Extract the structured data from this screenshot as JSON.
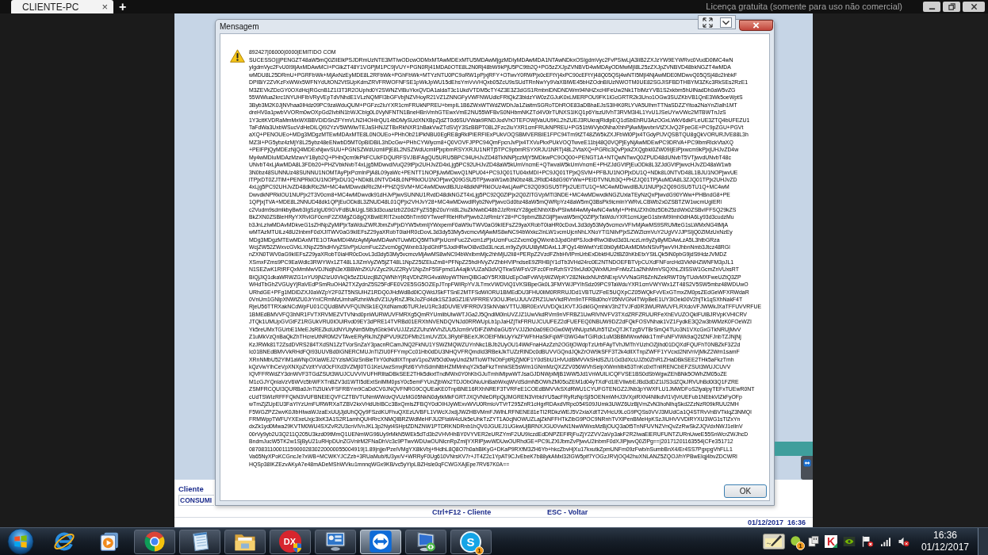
{
  "top_bar": {
    "tabs": [
      {
        "label": "CLIENTE-PC",
        "selected": true,
        "close": "×"
      }
    ],
    "new_tab": "+",
    "license_notice": "Licença gratuita (somente para uso não comercial)"
  },
  "remote_app": {
    "customer_label": "Cliente",
    "customer_value": "CONSUMI",
    "shortcuts": [
      "Ctrl+F12 - Cliente",
      "ESC - Voltar"
    ],
    "datetime": "01/12/2017  16:36"
  },
  "dialog": {
    "title": "Mensagem",
    "header": "892427|06000|0000|EMITIDO COM",
    "lines": [
      "SUCESSO|||PENGZT48aW5mQ0ZlIElkPSJDRmUzNTE3MTIwODcwODMxMTAwMDExMTU5MDAwMjgzMDIyMDAwMDA1NTAwNDkxOSIgdmVyc2FvPSIwLjA3IiB2ZXJzYW9EYWRvc0VudD0iMC4wN",
      "yIgdmVyc2FvU0I9IjAxMDAwMCI+PGlkZT48Y1VGPjM1PC9jVUY+PGN0Rj41MDA0OTE8L2N0Rj48bW9kPjU5PC9tb2Q+PG5zZXJpZVNBVD4wMDAyODMwMjI8L25zZXJpZVNBVD48bkNGZT4wMDA",
      "wMDU8L25DRmU+PGRFbWk+MjAxNzEyMDE8L2RFbWk+PGhFbWk+MTYzNTU0PC9oRW1pPjxjRFY+OTwvY0RWPjx0cEFtYj4xPC90cEFtYj48Q05QSj4wNTI5MjI4NjAwMDE0MDwvQ05QSj48c2lnbkF",
      "DPIBiY2ZVKzFxWWx5WFNYdUtON2VtSUpKdmZRVFRWOFNFSE1pWkJpWU15dEhsYmVvVHQxb05ZcU9sSUdTRnNwYy9VaXBiWE45bHZOdnBIUzNWOTM0UE82SGJISFBDTHBYM3ZKc3RkSEs2RzE1",
      "M3ZEVkZDcGY0OXdHcjRGcnB1Z1I3T3R2OUphd0Y2SWNZVlBuYkxQVDA1aldaT3c1UkdVTDM5cTY4Z3E3Z3dGS1RmbnlDNDNDWm94NHZxcHlFeUw2Nk1TblMzYVB1S2xkbm5hUlNadDh0aW5vZG",
      "55WWlua2krc1NYUHFIbVRyVEpTdVNhdE1VLzNQMFI3bGFVbjNZVHoyR21VZ1ZNNGFyVWFNWUdlcFRtQkZ3bldzYW0zZGJuK0xLMERPOU9FK1lGcGRTR2k3Uno1OGw3SUZKbVB1QnE3Wk5oeWptS",
      "3Byb3M2K0JjNVhaa0lHdz09PC9zaWduQUM+PGFzc2luYXR1cmFRUkNPREU+bmpIL1B6ZWxWTWdZWDhJa1ZiaitmSGRoTDhROE83aDBhaEJsS3lHK0RLYVA5UlhmTTNaSDZZYitoa2NaYnZIalh1MT",
      "dreHV0a1pwbVVORm0wOXpGd2IvblN1bWJCblg0L0VyNFNTN1BneHBnVmhGTEwxVmE2NU55WFBvS0NHbmNKZTd4V0lrTUNXS1lKQ1p6YiszUlVhT3RVM3l4L1YvU1JSeUYwVWc2MTBWTnJzS",
      "1Y3citKVDRaMmMxWXBBVDlDSnZFYmVLN2I4OHlrQU14bDMySUdXNXBpZjdZT0d6SUVWak9RNDJodVhOTEFOWjVaUU9KL2hZUEJ3RUkrajRidlpEQ1dSbEhRU3AzOGxLWkV6dkFLeUE3ZTQ4bUFEZU1",
      "TaFdWa3UxbWSucVdHeDlLQi92YzV5WWlwTEJaSHNJZTBxRkNXR1hBakVwZTdSVjY3SzBBPT08L2Fzc2luYXR1cmFRUkNPREU+PG51bWVyb0NhaXhhPjAwMjwvbnVtZXJvQ2FpeGE+PC9pZGU+PGVt",
      "aXQ+PENOUEo+MDg3MDgzMTEwMDAxMTE8L0NOUEo+PHhOb21lPkNBU0EgRE8gRklPIERFIExPUkVOQSBMVERBIE1FPC94Tm9tZT48ZW5kZXJFbWl0Pjx4TGdyPlJVQSBTQU8gQkVORURJVE88L3h",
      "MZ3I+PG5ybz4zMjY8L25ybz48eENwbD5MT0pBIDBIL3hDcGw+PHhCYWlycm8+Q0VOVFJPPC94QmFpcnJvPjx4TXVuPkxPUkVOQTwveE11bj48Q0VQPjEyNjAwMDEwPC9DRVA+PC9lbmRlckVtaXQ",
      "+PElFPjQyMDEzNjQ4MDExNjwvSUU+PGNSZWdUcmliPjE8L2NSZWdUcmliPjxpbmRSYXRJU1NRTj5TPC9pbmRSYXRJU1NRTj48L2VtaXQ+PGRlc3QvPjxkZXQgbkl0ZW09IjEiPjxwcm9kPjxjUHJvZD4w",
      "My4wMDIuMDAzMzwvY1Byb2Q+PHhQcm9kPkFCUkFDQURFSVJBIFAgQU5URU5BPC94UHJvZD48TkNNPjczMjY5MDkwPC9OQ00+PENGT1A+NTQwNTwvQ0ZPUD48dUNvbT5VTjwvdUNvbT48c",
      "UNvbT4xLjAwMDA8L3FDb20+PHZVbkNvbT4xLjg5MDwvdlVuQ29tPjx2UHJvZD4xLjg5PC92UHJvZD48aW5kUmVncmE+QTwvaW5kUmVncmE+PHZJdGVtPjEuODk8L3ZJdGVtPjwvcHJvZD48aW1wb",
      "3N0bz48SUNNUz48SUNNU1NOMTAyPjxPcmlnPjA8L09yaWc+PENTT1NOPjUwMDwvQ1NPU04+PC9JQ01TU04xMDI+PC9JQ01TPjxQSVM+PFBJU1NOPjxDU1Q+NDk8L0NTVD48L1BJU1NOPjwvUE",
      "lTPjxDT0ZJTlM+PENPRklOU1NOPjxDU1Q+NDk8L0NTVD48L0NPRklOU1NOPjwvQ09GSU5TPjwvaW1wb3N0bz48L2RldD48dG90YWw+PElDTVNUb3Q+PHZJQ01TPjAuMDA8L3ZJQ01TPjx2UHJvZD",
      "4xLjg5PC92UHJvZD48dkRlc2M+MC4wMDwvdkRlc2M+PHZQSVM+MC4wMDwvdlBJUz48dkNPRklOUz4wLjAwPC92Q09GSU5TPjx2UElTU1Q+MC4wMDwvdlBJU1NUPjx2Q09GSU5TU1Q+MC4wM",
      "DwvdkNPRklOU1NUPjx2T3V0cm8+MC4wMDwvdk91dHJvPjwvSUNNU1RvdD48dkNGZT4xLjg5PC92Q0ZlPjx2Q0ZlTGVpMTI3NDE+MC4wMDwvdkNGZUxlaTEyNzQxPjwvdG90YWw+PHBndG8+PE",
      "1QPjxjTVA+MDE8L2NNUD48dk1QPjEuODk8L3ZNUD48L01QPjx2VHJvY28+MC4wMDwvdlRyb2NvPjwvcGd0bz48aW5mQWRpYz48aW5mQ3BsPk9icmlnYWRvLCBWb2x0ZSBTZW1wcmUgIERl",
      "c2Vudm9sdmlkbyBwb3IgSzIgU09GVFdBUkUgLSB3d3cuazIzb2Z0d2FyZS5jb20uYnI8L2luZkNwbD48b2JzRmlzY28geENhbXBvPSIwMi4wMy4wNC4wMyI+PHhUZXh0bz5Db25zdWx0ZSBvIFFSQ29kZS",
      "BkZXN0ZSBleHRyYXRvIGF0cmF2ZXMgZG8gQXBwIERlT2xob05hTm90YTwveFRleHRvPjwvb2JzRmlzY28+PC9pbmZBZGljPjwvaW5mQ0ZlPjxTaWduYXR1cmUgeG1sbnM9Imh0dHA6Ly93d3cudzMu",
      "b3JnLzIwMDAvMDkveG1sZHNpZyMiPjxTaWduZWRJbmZvPjxDYW5vbmljYWxpemF0aW9uTWV0aG9kIEFsZ29yaXRobT0iaHR0cDovL3d3dy53My5vcmcvVFIvMjAwMS9SRUMteG1sLWMxNG4tMjA",
      "wMTAzMTUiLz48U2lnbmF0dXJlTWV0aG9kIEFsZ29yaXRobT0iaHR0cDovL3d3dy53My5vcmcvMjAwMS8wNC94bWxkc2lnLW1vcmUjcnNhLXNoYTI1NiIvPjxSZWZlcmVuY2UgVVJJPSIjQ0ZlMzUxNzEy",
      "MDg3MDgzMTEwMDAxMTE1OTAwMDI4MzAyMjAwMDAwNTUwMDQ5MTkiPjxUcmFuc2Zvcm1zPjxUcmFuc2Zvcm0gQWxnb3JpdGhtPSJodHRwOi8vd3d3LnczLm9yZy8yMDAwLzA5L3htbGRza",
      "WcjZW52ZWxvcGVkLXNpZ25hdHVyZSIvPjxUcmFuc2Zvcm0gQWxnb3JpdGhtPSJodHRwOi8vd3d3LnczLm9yZy9UUi8yMDAxL1JFQy14bWwtYzE0bi0yMDAxMDMxNSIvPjwvVHJhbnNmb3Jtcz48RGl",
      "nZXN0TWV0aG9kIEFsZ29yaXRobT0iaHR0cDovL3d3dy53My5vcmcvMjAwMS8wNC94bWxlbmMjc2hhMjU2Ii8+PERpZ2VzdFZhbHVlPmUrbExDbktHU2tBZ0hKbEtxYStLQk5iN0pbG9jdStHdzJVMDZ",
      "XSmxFZms9PC9EaWdlc3RWYWx1ZT48L1JlZmVyZW5jZT48L1NpZ25lZEluZm8+PFNpZ25hdHVyZVZhbHVlPndseE9ZRHBjY1dTb3VHd24rc0E2NTNDOEFBTVpCUXdFNForcHd3VkNHZWNFM3pJL1",
      "N1SEZwK1RtRFQxMmMwVDJNdjN3eXBBWnZKUVZyc29UZ2RyV1NpZnF5SFpmd1A4ajlkVUZaN3dVQTkwSWFsV2Fzc0FmRzhSY29xUld0QWxMUmFnMzZ1a2NhMmVSQXhLZllSSW1GcmZnVUxsRT",
      "BiQjJiQ1dkaWRWZG1nYU9jN2IzU0VkQk5zZDUzcjBZQWNhYjRqVDhZRG4vaWoyWTNmQlBGa0Y5RXBUcEpOalFvWVpWZWpKY282NkdxNUh5NExpVVVNaGR6ZnNZekRWT0tyTUdvMXFweUZtQ3ZP",
      "WHdTbGhZVGUyYjRaVEdPSmRuOHA2TXZydnZ5S25FdFE0V2E5SG5OZEpJTnpFWlRpYVJLTmxVWDViQ1VKSlBpeGk0L3FMYWJPYlhSdz09PC9TaWduYXR1cmVWYWx1ZT48S2V5SW5mbz48WDUwO",
      "URhdGE+PFg1MDlDZXJ0aWZpY2F0ZT5NSUlHZ1RDQ0JHdWdBd0lCQWdJSkFTSnE2MTFSdWlORU1BMEdDU3FHU0liM0RRRUJDd1VBTUZFeE5UQXpCZ05WQkFvVExGTmxZM0psZEdGeWFXRWdaR",
      "0VnUm1GNlpXNWtZU0JrYnlCRmMzUmhaRzhnWkdVZ1UyRnZJRkJoZFd4dk1SZ3dGZ1lEVlFRREV3OUJReUJUUVZRZ1UwVkdRVm9nTFRBd0hoY05NVGN4TWpBeE1UY3lOek00V2hjTk1qSXhNakF4T",
      "RjeU56TTRXakNCdWpFU01CQUdBMVVFQlJNSk1EQXdNamd6TURJeU1Rc3dDUVlEVlFRR0V3SkNVakVTTUJBR0ExVUVDQk1KVTJGdklGQmhkV3h2TVJFd0R3WURWUVFLRXdoVFJWWkJXaTFFUVVRFUE",
      "1BMEdBMVVFQ3hNR1FVTXRVMEZVTVNnd0pnWURWUVFMRXg5QmRYUmlibUlwWTJGa2J5QndiM0lnUVZJZ1UwVkdRVm9nVFRBZ1UwRlVNVFV3TXdZRFZRUURFeXhEVUZOQklFUlBJRVpKVHlCRV",
      "JTQk1UMUpGVGtFZ1RGUkVRU0lOUlRvd09EY3dPRE14TVRBd01ERXhNVENDQVNJd0RRWUpLb1pJaHZjTkFRRUJCUUFEZ2dFUEFEQ0NBUW9DZ2dFQkFOSVNhak1VZ1FydkE3Q2w3bWMzK0FOeWZI",
      "Yk5reUMxTGUrbE1MeEJsREZkdUdNYUtyNm5MbytGbk94VUJJZzlZZUhzWVhZUU5Jcm9rVDlFZWh0aGU5YVJJZkh0a09EOGw0WjVlNUpzMUh5TlZxQTJKTzg5VTBrSmQ4TUo3N1VXcGxGTkNRUjMvV",
      "Z1uMkVzQnBaQkZhTHcreUtNR0M2VTAveERyRkJhZjNPVU9IZDFMb21mUVZDL3RybFBEeXJKOEtFMkUyYkZFWFhHaSkFqWFI3WG4wTGlRck1uM3BBMWxwNkk1TmFuNFVlWk9aQ2tZNFJnbTZJNjNj",
      "KzJRWk81T2ZsdDVRS284TXdSN1ZzTVorSnZaY3pacnRCamJNQ2FkNU1YSWZMQWZUYnNkc1BJb2UyOU14WkFnaHAzZzh2OGtjOWdpTzUrbFAyTVhJMThYUzhOZjlhd01DQXdFQUFhT0NBZkF3Z2d",
      "Ic01BNEdBMVVkRHdFQi93UUVBd0lGNERCMUJnTlZIU0FFYmpCc01Hb0dDU3NHQVFRQmdId3RBekJkTUZzRlNDc0dBUVVGQndJQkZrOW9kSFF3T2k4dlIXTnpZWFF1YVcxd2NtVnVjMkZ2Wm1samF",
      "XRnNMbU52YlM1aWNpOXlaWEJ2YzlsMGlzSnBieTlrY0dNdlIXTnpaV1poZW5Od0wyUndZMTIoWTNObFptRjZjM0F1Y0dSbU1HVUdBMVVkSHdSZU1Gd3dXcUJZb0ZhR1ZHaDBkSEE2THk5aFkzTmh",
      "kQzVwYlhCeVpXNXpZVzltYVdOcFlXd3VZMjI0TG1KeUwzSmxjRzl6YVhSdmNtbHZMMnhqY2k5aFkzTmhkSE5sWm1GNmMzQXZZV056WVhSelpXWmhlbk53TnKc0xtTnlIRENCbEFZSUt3WUJCUVV",
      "IQVFFRWdZY3dnWVF3TGdZSUt3WUJCUVVIVUFHRlltaDBkSEE2THk5dkxtTndMWx0Y0hKbGJuTmhiMlpwWTJsaGJDNWpiMjB1WW5Jd1VnWUlLlCQFVSE1BS0dSbWgwZEhBNk5OWhZM05oZE",
      "M1cGJYQnlaVzV6WVc5bWFXTnBZV3d1WTI5dExtSnlMM0psY0c5emFYUnZjbWx2TDJObGNuUnBabWxqWVdSdmN5OWhZM05oZEM1d04yTXdFd1lEVlIwbEJBd3dDZ1lJS3dZQkJRVUhBd0l3Q1FZRE",
      "ZSMFRCQUI3QURBa0JnTlZIUkVFSFRBYm9CaDdCV0JNQVFNRG9CQUEaKE0TnpBNE16RXhNREF3TVRFeE1COEdBMVVkSXdRWU1CYUFGTENGZ2JNb3pYWXFLU1JMWDFoS2lyalpyTEFxTUEwR0NT",
      "cUdTSWIzRFFFQkN3VUFBNElEQVFCZTBVTUNmWWdvQVUzMG05NkN0dytkMkFGRTJXQVNIeDRpQjJMGREN3VrbldYU5acFRyRzNpSjI5OENmWHJ3VXpiRXN4NllkdVl1VjVrUEFub1NEbkVlZkFyOFp",
      "wTmZjZUpEU3FaYlYzUmFURWRXaTZBV2kxVHdUbIBCc3BxQmlsZFBQY0dOIHJyWExvWVU0RmloVTVrT295ZnR1cHgrRDAxdVRpc054S09JUmk3UWZ6UzBjVmZvN3hoNlhqSkd2ZzNzR09kRUU2MH",
      "F5WGZPZ2wvK0JlbHIwaWJzaExUUjJjdUhQQy9FSzdKUFhuQXEzUVBFL1VWcXJxdjJWZHBVMmFJWlhLRFNENE81eTI2RDkzWEJ5V2xiaXdtT2VHcU9LcG9PQSs0VVJ3MUdCa1Q4STRvVnBVTklqZ3NMQl",
      "FRMWppTWFUYXExeUxjc3lxK3A1S2R1amhQUHRrcXNMQlBRZWdMeHFJU2FtaW4cUk5eUhkTzZYT1A0cjNOWUZLajZkNFFHTkZibG9POC9NRnhTVXlPenBMeHpKSzJIUHVVVDlRYXU3WG1sTlZxYn",
      "dxZk1yd0Mwa29KVTM0WU4SXZvR2U3cnViVnJKL3p2Nyt4SHptZDNZNW1PTDRKNDRnb1hQV0JGUEJ1UGkwUjBRNXJGU0VwN1NwWWxsMzBjOUQ3a0t5TnNFUVNZVnQvZzRwSkZJQVdxNWJ1ellnV",
      "00rVy9yb2U3Q211Q205U3kzd09tMmQ1UENmWG96Uy9rMkN5WEk5dTd3b2VHVHhBY0VYVER2eURZYmF2UU9IczdEdDNPZEFiRjFuZjY2ZVV2aVp3akF2R2IwaElERUFUNTZURnUweE55SnWcrZWJhcD",
      "BndmJucW5TK2w1SjByU21uRHpDUnZGVnlrM2FNaDhVc3c9PTwvWDUwOUNlcnRpZmljYXRlPjwvWDUwOURhdGE+PC9LZXlJbmZvPjwvU2lnbmF0dXJlPjwvQ0ZlPg==|20171201163554|CFe351712",
      "08708311000111590002830220000055004919|1.89|njje/PzelVMgYX8lkVbj+fHdhL8Q8O7h0ahBlKyG+DKaP9RXfM3ZH6Yb+hkcZbvHjXu17kxutkZpmUNFm09zFwb/nSumbBnX4/Er4SS7PgxpgVhFLL1",
      "Va65NyXPoKCGncJe7xWB+MCWKYJCZzb+3RUaMub/tU3yx/V+WRRyF0Ug610VNrsKV7r+JT4Z2c1YpAT9CJvEbeK7b88ykAMxl32lGW5pif7YOGzJRVjOQ42huXNLANZ5ZQOJ/hYPBwEIqj4bvZDCWRI",
      "HQSp38IKZEzvAKyA7e48mADeMShWVku1mnnqWGx9KB/vc5yYipLBZHsle0qFCWGXAjEpe7RV67K0A=="
    ],
    "ok_button": "OK"
  },
  "taskbar": {
    "apps": [
      {
        "kind": "browser",
        "running": false,
        "selected": false
      },
      {
        "kind": "player",
        "running": false,
        "selected": false
      },
      {
        "kind": "wheel",
        "running": true,
        "selected": false
      },
      {
        "kind": "notepad",
        "running": true,
        "selected": false
      },
      {
        "kind": "folder",
        "running": true,
        "selected": false
      },
      {
        "kind": "shielded-letters",
        "text": "DX",
        "running": true,
        "selected": false
      },
      {
        "kind": "dashboard",
        "running": true,
        "selected": false
      },
      {
        "kind": "arrows",
        "running": true,
        "selected": true
      },
      {
        "kind": "remote",
        "running": true,
        "selected": false
      },
      {
        "kind": "cloud-letters",
        "text": "S",
        "badge": "1",
        "running": true,
        "selected": false
      }
    ],
    "tray": [
      {
        "kind": "pad"
      },
      {
        "kind": "ball",
        "badge": "1"
      },
      {
        "kind": "plug"
      },
      {
        "kind": "letter",
        "text": "K"
      },
      {
        "kind": "card"
      },
      {
        "kind": "flag"
      },
      {
        "kind": "bars"
      },
      {
        "kind": "speaker"
      }
    ],
    "time": "16:36",
    "date": "01/12/2017"
  }
}
